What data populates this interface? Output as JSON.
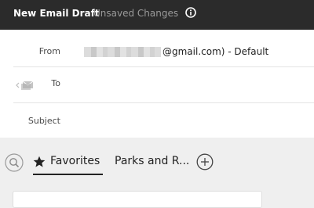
{
  "header": {
    "title": "New Email Draft",
    "status": "Unsaved Changes",
    "info_icon": "info-icon"
  },
  "form": {
    "from_label": "From",
    "from_value_suffix": "@gmail.com) - Default",
    "to_label": "To",
    "subject_label": "Subject",
    "to_icon": "envelope-icon"
  },
  "tabs": {
    "search_icon": "search-icon",
    "items": [
      {
        "label": "Favorites",
        "icon": "star-icon",
        "active": true
      },
      {
        "label": "Parks and R...",
        "active": false
      }
    ],
    "add_icon": "plus-circle-icon"
  },
  "colors": {
    "topbar": "#2b2b2b",
    "background": "#efefef",
    "text": "#222222"
  }
}
